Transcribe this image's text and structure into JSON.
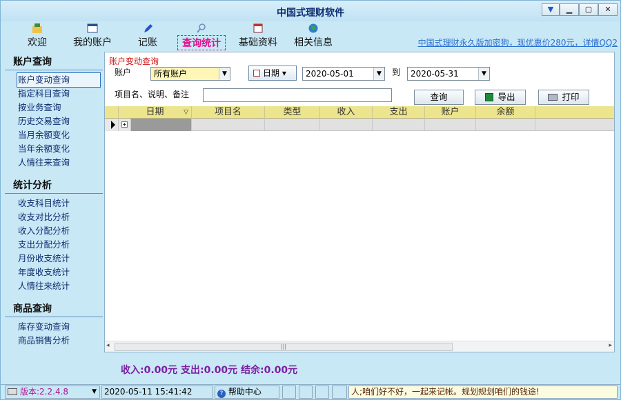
{
  "window": {
    "title": "中国式理财软件",
    "buttons": [
      "▼",
      "▭",
      "□",
      "✕"
    ]
  },
  "toolbar": {
    "items": [
      {
        "label": "欢迎",
        "icon": "welcome-icon"
      },
      {
        "label": "我的账户",
        "icon": "account-icon"
      },
      {
        "label": "记账",
        "icon": "pen-icon"
      },
      {
        "label": "查询统计",
        "icon": "search-icon",
        "active": true
      },
      {
        "label": "基础资料",
        "icon": "calendar-icon"
      },
      {
        "label": "相关信息",
        "icon": "globe-icon"
      }
    ],
    "promo": "中国式理财永久版加密狗，现优惠价280元，详情QQ2"
  },
  "sidebar": {
    "sections": [
      {
        "title": "账户查询",
        "items": [
          "账户变动查询",
          "指定科目查询",
          "按业务查询",
          "历史交易查询",
          "当月余额变化",
          "当年余额变化",
          "人情往来查询"
        ]
      },
      {
        "title": "统计分析",
        "items": [
          "收支科目统计",
          "收支对比分析",
          "收入分配分析",
          "支出分配分析",
          "月份收支统计",
          "年度收支统计",
          "人情往来统计"
        ]
      },
      {
        "title": "商品查询",
        "items": [
          "库存变动查询",
          "商品销售分析"
        ]
      }
    ]
  },
  "panel": {
    "title": "账户变动查询",
    "account_label": "账户",
    "account_value": "所有账户",
    "date_button": "日期",
    "date_from": "2020-05-01",
    "to_label": "到",
    "date_to": "2020-05-31",
    "keyword_label": "项目名、说明、备注",
    "keyword_value": "",
    "query_btn": "查询",
    "export_btn": "导出",
    "print_btn": "打印"
  },
  "grid": {
    "columns": [
      "日期",
      "项目名",
      "类型",
      "收入",
      "支出",
      "账户",
      "余额"
    ],
    "rows": []
  },
  "totals": {
    "text": "收入:0.00元 支出:0.00元 结余:0.00元"
  },
  "status": {
    "version": "版本:2.2.4.8",
    "datetime": "2020-05-11 15:41:42",
    "help": "帮助中心",
    "message": "人;咱们好不好，一起来记帐。规划规划咱们的钱途!"
  },
  "colors": {
    "accent": "#e00f8c",
    "grid_header": "#ece58e",
    "totals": "#7b1fa2"
  }
}
